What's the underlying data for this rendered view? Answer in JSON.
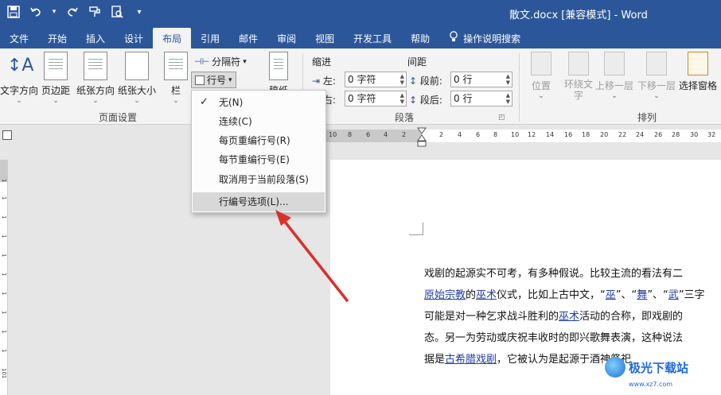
{
  "app": {
    "title": "散文.docx [兼容模式]  -  Word",
    "qat_more": "▾"
  },
  "tabs": [
    {
      "label": "文件"
    },
    {
      "label": "开始"
    },
    {
      "label": "插入"
    },
    {
      "label": "设计"
    },
    {
      "label": "布局",
      "active": true
    },
    {
      "label": "引用"
    },
    {
      "label": "邮件"
    },
    {
      "label": "审阅"
    },
    {
      "label": "视图"
    },
    {
      "label": "开发工具"
    },
    {
      "label": "帮助"
    },
    {
      "label": "操作说明搜索"
    }
  ],
  "ribbon": {
    "page_setup": {
      "text_direction": "文字方向",
      "margins": "页边距",
      "orientation": "纸张方向",
      "size": "纸张大小",
      "columns": "栏",
      "breaks": "分隔符",
      "line_numbers": "行号",
      "hyphenation": "稿纸",
      "group_label": "页面设置"
    },
    "paragraph": {
      "indent_label": "缩进",
      "spacing_label": "间距",
      "left_label": "左:",
      "right_label": "右:",
      "left_value": "0 字符",
      "right_value": "0 字符",
      "before_label": "段前:",
      "after_label": "段后:",
      "before_value": "0 行",
      "after_value": "0 行",
      "group_label": "段落"
    },
    "arrange": {
      "position": "位置",
      "wrap_text": "环绕文字",
      "bring_forward": "上移一层",
      "send_backward": "下移一层",
      "selection_pane": "选择窗格",
      "group_label": "排列"
    }
  },
  "line_numbers_menu": {
    "items": [
      {
        "label": "无(N)",
        "checked": true
      },
      {
        "label": "连续(C)"
      },
      {
        "label": "每页重编行号(R)"
      },
      {
        "label": "每节重编行号(E)"
      },
      {
        "label": "取消用于当前段落(S)"
      },
      {
        "label": "行编号选项(L)...",
        "highlighted": true
      }
    ]
  },
  "ruler": {
    "numbers": [
      "10",
      "8",
      "6",
      "4",
      "2",
      "2",
      "4",
      "6",
      "8",
      "10",
      "12",
      "14",
      "16",
      "18",
      "20",
      "22",
      "24",
      "26",
      "28",
      "30",
      "32",
      "34",
      "36"
    ],
    "v_numbers": [
      "1",
      "1",
      "1",
      "1",
      "1",
      "1",
      "1",
      "1",
      "1",
      "1",
      "101"
    ]
  },
  "document": {
    "lines": [
      [
        {
          "t": "戏剧的起源实不可考，有多种假说。比较主流的看法有二"
        }
      ],
      [
        {
          "t": "原始宗教",
          "link": true
        },
        {
          "t": "的"
        },
        {
          "t": "巫术",
          "link": true
        },
        {
          "t": "仪式，比如上古中文，“"
        },
        {
          "t": "巫",
          "link": true
        },
        {
          "t": "”、“"
        },
        {
          "t": "舞",
          "link": true
        },
        {
          "t": "”、“"
        },
        {
          "t": "武",
          "link": true
        },
        {
          "t": "”三字"
        }
      ],
      [
        {
          "t": "可能是对一种乞求战斗胜利的"
        },
        {
          "t": "巫术",
          "link": true
        },
        {
          "t": "活动的合称，即戏剧的"
        }
      ],
      [
        {
          "t": "态。另一为劳动或庆祝丰收时的即兴歌舞表演，这种说法"
        }
      ],
      [
        {
          "t": "据是"
        },
        {
          "t": "古希腊戏剧",
          "link": true
        },
        {
          "t": "，它被认为是起源于酒神祭祀"
        }
      ]
    ]
  },
  "watermark": {
    "name": "极光下载站",
    "url": "www.xz7.com"
  },
  "colors": {
    "accent": "#2b579a",
    "arrow": "#d9302c",
    "link": "#1f3ea8"
  }
}
